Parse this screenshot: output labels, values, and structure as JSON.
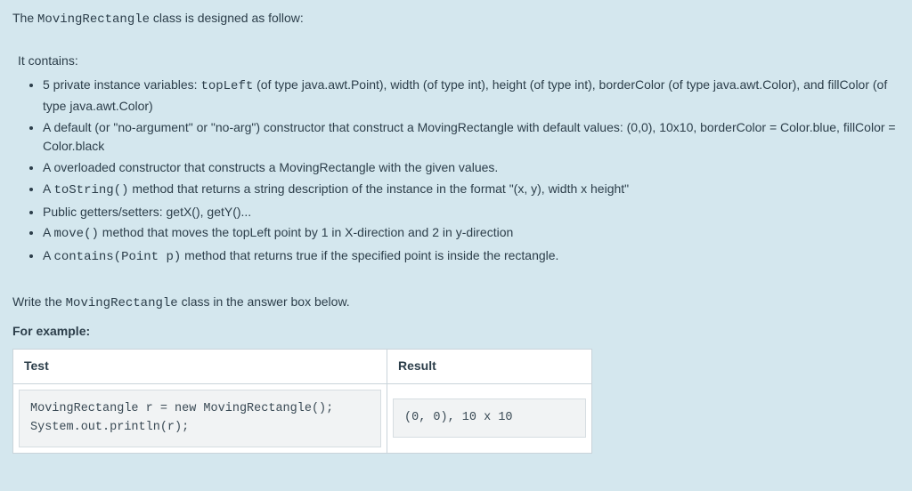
{
  "intro": {
    "prefix": "The ",
    "classname": "MovingRectangle",
    "suffix": " class is designed as follow:"
  },
  "contains_label": "It contains:",
  "bullets": [
    {
      "parts": [
        {
          "t": "5 private instance variables: "
        },
        {
          "t": "topLeft",
          "mono": true
        },
        {
          "t": " (of type java.awt.Point), width (of type int), height (of type int), borderColor (of type java.awt.Color), and fillColor (of type java.awt.Color)"
        }
      ]
    },
    {
      "parts": [
        {
          "t": "A default (or \"no-argument\" or \"no-arg\") constructor that construct a MovingRectangle with default values: (0,0), 10x10, borderColor = Color.blue, fillColor = Color.black"
        }
      ]
    },
    {
      "parts": [
        {
          "t": "A overloaded constructor that constructs a MovingRectangle with the given values."
        }
      ]
    },
    {
      "parts": [
        {
          "t": "A "
        },
        {
          "t": "toString()",
          "mono": true
        },
        {
          "t": " method that returns a string description of the instance in the format \"(x, y), width x height\""
        }
      ]
    },
    {
      "parts": [
        {
          "t": "Public getters/setters: getX(), getY()..."
        }
      ]
    },
    {
      "parts": [
        {
          "t": "A "
        },
        {
          "t": "move()",
          "mono": true
        },
        {
          "t": " method that moves the topLeft point by 1 in X-direction and 2 in y-direction"
        }
      ]
    },
    {
      "parts": [
        {
          "t": "A "
        },
        {
          "t": "contains(Point p)",
          "mono": true
        },
        {
          "t": " method that returns true if the specified point is inside the rectangle."
        }
      ]
    }
  ],
  "write_line": {
    "prefix": "Write the ",
    "classname": "MovingRectangle",
    "suffix": " class in the answer box below."
  },
  "for_example": "For example:",
  "table": {
    "headers": {
      "test": "Test",
      "result": "Result"
    },
    "rows": [
      {
        "test": "MovingRectangle r = new MovingRectangle();\nSystem.out.println(r);",
        "result": "(0, 0), 10 x 10"
      }
    ]
  }
}
